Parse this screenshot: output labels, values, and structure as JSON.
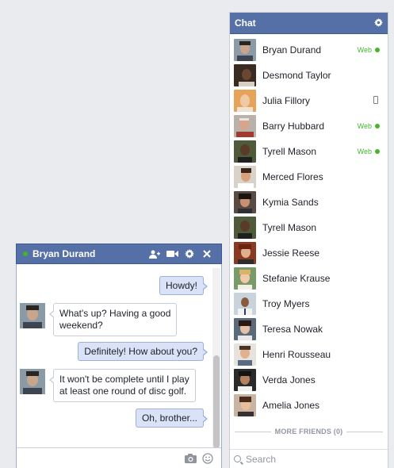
{
  "chat_panel": {
    "title": "Chat",
    "more_friends": "MORE FRIENDS (0)",
    "search_placeholder": "Search",
    "friends": [
      {
        "name": "Bryan Durand",
        "status": "Web"
      },
      {
        "name": "Desmond Taylor",
        "status": ""
      },
      {
        "name": "Julia Fillory",
        "status": "mobile"
      },
      {
        "name": "Barry Hubbard",
        "status": "Web"
      },
      {
        "name": "Tyrell Mason",
        "status": "Web"
      },
      {
        "name": "Merced Flores",
        "status": ""
      },
      {
        "name": "Kymia Sands",
        "status": ""
      },
      {
        "name": "Tyrell Mason",
        "status": ""
      },
      {
        "name": "Jessie Reese",
        "status": ""
      },
      {
        "name": "Stefanie Krause",
        "status": ""
      },
      {
        "name": "Troy Myers",
        "status": ""
      },
      {
        "name": "Teresa Nowak",
        "status": ""
      },
      {
        "name": "Henri Rousseau",
        "status": ""
      },
      {
        "name": "Verda Jones",
        "status": ""
      },
      {
        "name": "Amelia Jones",
        "status": ""
      }
    ]
  },
  "conversation": {
    "contact_name": "Bryan Durand",
    "messages": [
      {
        "from": "me",
        "text": "Howdy!"
      },
      {
        "from": "them",
        "line1": "What's up? Having a good",
        "line2": "weekend?"
      },
      {
        "from": "me",
        "text": "Definitely! How about you?"
      },
      {
        "from": "them",
        "line1": "It won't be complete until I play",
        "line2": "at least one round of disc golf."
      },
      {
        "from": "me",
        "text": "Oh, brother..."
      }
    ]
  },
  "colors": {
    "header_blue": "#5570a6",
    "online_green": "#42b72a",
    "outgoing_bubble": "#d9e2f6"
  },
  "icons": {
    "panel_settings": "gear-icon",
    "add_friend": "add-friend-icon",
    "video": "video-camera-icon",
    "settings": "gear-icon",
    "close": "close-icon",
    "photo": "camera-icon",
    "emoji": "smiley-icon",
    "search": "search-icon"
  }
}
